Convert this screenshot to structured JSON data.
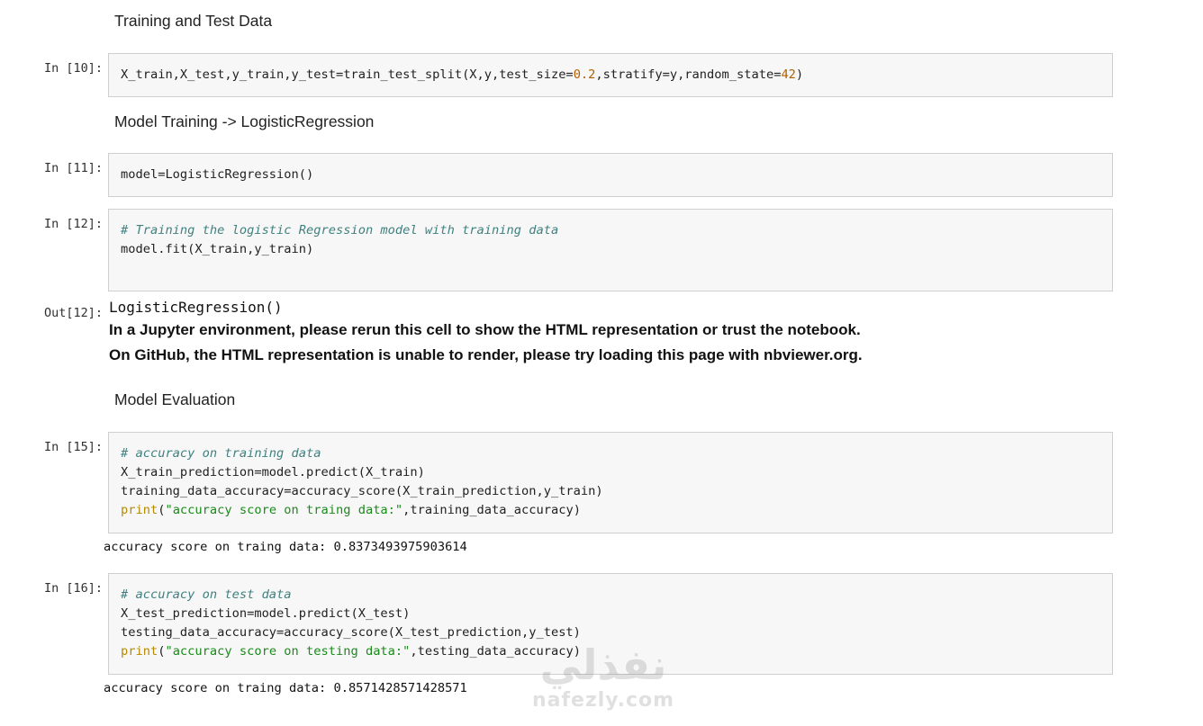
{
  "headings": {
    "training_test": "Training and Test Data",
    "model_training": "Model Training -> LogisticRegression",
    "model_evaluation": "Model Evaluation"
  },
  "cells": {
    "c10": {
      "prompt": "In [10]:",
      "line1_a": "X_train,X_test,y_train,y_test=train_test_split(X,y,test_size=",
      "line1_n1": "0.2",
      "line1_b": ",stratify=y,random_state=",
      "line1_n2": "42",
      "line1_c": ")"
    },
    "c11": {
      "prompt": "In [11]:",
      "line1": "model=LogisticRegression()"
    },
    "c12": {
      "prompt": "In [12]:",
      "comment": "# Training the logistic Regression model with training data",
      "line2": "model.fit(X_train,y_train)",
      "out_prompt": "Out[12]:",
      "repr": "LogisticRegression()",
      "warn1": "In a Jupyter environment, please rerun this cell to show the HTML representation or trust the notebook.",
      "warn2": "On GitHub, the HTML representation is unable to render, please try loading this page with nbviewer.org."
    },
    "c15": {
      "prompt": "In [15]:",
      "comment": "# accuracy on training data",
      "line2": "X_train_prediction=model.predict(X_train)",
      "line3": "training_data_accuracy=accuracy_score(X_train_prediction,y_train)",
      "print_kw": "print",
      "print_open": "(",
      "print_str": "\"accuracy score on traing data:\"",
      "print_rest": ",training_data_accuracy)",
      "output": "accuracy score on traing data: 0.8373493975903614"
    },
    "c16": {
      "prompt": "In [16]:",
      "comment": "# accuracy on test data",
      "line2": "X_test_prediction=model.predict(X_test)",
      "line3": "testing_data_accuracy=accuracy_score(X_test_prediction,y_test)",
      "print_kw": "print",
      "print_open": "(",
      "print_str": "\"accuracy score on testing data:\"",
      "print_rest": ",testing_data_accuracy)",
      "output": "accuracy score on traing data: 0.8571428571428571"
    }
  },
  "watermark": {
    "arabic": "نفذلي",
    "latin": "nafezly.com"
  }
}
